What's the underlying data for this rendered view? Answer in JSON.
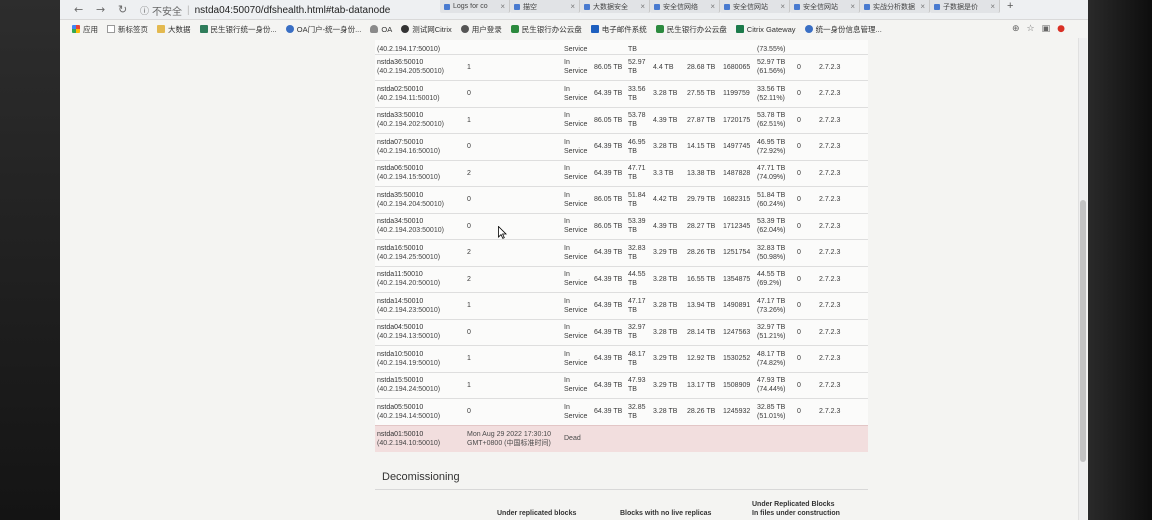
{
  "browser": {
    "tabs": [
      "Logs for co",
      "描空",
      "大数据安全",
      "安全信网络",
      "安全信网站",
      "安全信网站",
      "实战分析数据",
      "子数据是价"
    ],
    "security_label": "不安全",
    "url": "nstda04:50070/dfshealth.html#tab-datanode",
    "bookmarks": [
      {
        "label": "应用",
        "icon": "apps-icon"
      },
      {
        "label": "新标签页",
        "icon": "page-icon"
      },
      {
        "label": "大数据",
        "icon": "folder-icon"
      },
      {
        "label": "民生银行统一身份...",
        "icon": "bank-icon"
      },
      {
        "label": "OA门户-统一身份...",
        "icon": "globe-icon"
      },
      {
        "label": "OA",
        "icon": "cloud-icon"
      },
      {
        "label": "测试网Citrix",
        "icon": "citrix-icon"
      },
      {
        "label": "用户登录",
        "icon": "paw-icon"
      },
      {
        "label": "民生银行办公云盘",
        "icon": "drive-icon"
      },
      {
        "label": "电子邮件系统",
        "icon": "mail-icon"
      },
      {
        "label": "民生银行办公云盘",
        "icon": "drive-icon"
      },
      {
        "label": "Citrix Gateway",
        "icon": "gateway-icon"
      },
      {
        "label": "统一身份信息管理...",
        "icon": "globe-icon"
      }
    ],
    "toolbar_icons": [
      "zoom-icon",
      "bookmark-star-icon",
      "extension-icon",
      "profile-icon"
    ]
  },
  "datanodes": {
    "partial_row": {
      "address": "(40.2.194.17:50010)",
      "admin_state": "Service",
      "used": "TB",
      "block_pool_percent": "(73.55%)"
    },
    "rows": [
      {
        "node": "nstda36:50010",
        "address": "(40.2.194.205:50010)",
        "last_contact": "1",
        "admin_state": "In Service",
        "capacity": "86.05 TB",
        "used": "52.97 TB",
        "non_dfs_used": "4.4 TB",
        "remaining": "28.68 TB",
        "blocks": "1680065",
        "block_pool_used": "52.97 TB",
        "block_pool_percent": "(61.56%)",
        "failed_volumes": "0",
        "version": "2.7.2.3"
      },
      {
        "node": "nstda02:50010",
        "address": "(40.2.194.11:50010)",
        "last_contact": "0",
        "admin_state": "In Service",
        "capacity": "64.39 TB",
        "used": "33.56 TB",
        "non_dfs_used": "3.28 TB",
        "remaining": "27.55 TB",
        "blocks": "1199759",
        "block_pool_used": "33.56 TB",
        "block_pool_percent": "(52.11%)",
        "failed_volumes": "0",
        "version": "2.7.2.3"
      },
      {
        "node": "nstda33:50010",
        "address": "(40.2.194.202:50010)",
        "last_contact": "1",
        "admin_state": "In Service",
        "capacity": "86.05 TB",
        "used": "53.78 TB",
        "non_dfs_used": "4.39 TB",
        "remaining": "27.87 TB",
        "blocks": "1720175",
        "block_pool_used": "53.78 TB",
        "block_pool_percent": "(62.51%)",
        "failed_volumes": "0",
        "version": "2.7.2.3"
      },
      {
        "node": "nstda07:50010",
        "address": "(40.2.194.16:50010)",
        "last_contact": "0",
        "admin_state": "In Service",
        "capacity": "64.39 TB",
        "used": "46.95 TB",
        "non_dfs_used": "3.28 TB",
        "remaining": "14.15 TB",
        "blocks": "1497745",
        "block_pool_used": "46.95 TB",
        "block_pool_percent": "(72.92%)",
        "failed_volumes": "0",
        "version": "2.7.2.3"
      },
      {
        "node": "nstda06:50010",
        "address": "(40.2.194.15:50010)",
        "last_contact": "2",
        "admin_state": "In Service",
        "capacity": "64.39 TB",
        "used": "47.71 TB",
        "non_dfs_used": "3.3 TB",
        "remaining": "13.38 TB",
        "blocks": "1487828",
        "block_pool_used": "47.71 TB",
        "block_pool_percent": "(74.09%)",
        "failed_volumes": "0",
        "version": "2.7.2.3"
      },
      {
        "node": "nstda35:50010",
        "address": "(40.2.194.204:50010)",
        "last_contact": "0",
        "admin_state": "In Service",
        "capacity": "86.05 TB",
        "used": "51.84 TB",
        "non_dfs_used": "4.42 TB",
        "remaining": "29.79 TB",
        "blocks": "1682315",
        "block_pool_used": "51.84 TB",
        "block_pool_percent": "(60.24%)",
        "failed_volumes": "0",
        "version": "2.7.2.3"
      },
      {
        "node": "nstda34:50010",
        "address": "(40.2.194.203:50010)",
        "last_contact": "0",
        "admin_state": "In Service",
        "capacity": "86.05 TB",
        "used": "53.39 TB",
        "non_dfs_used": "4.39 TB",
        "remaining": "28.27 TB",
        "blocks": "1712345",
        "block_pool_used": "53.39 TB",
        "block_pool_percent": "(62.04%)",
        "failed_volumes": "0",
        "version": "2.7.2.3"
      },
      {
        "node": "nstda16:50010",
        "address": "(40.2.194.25:50010)",
        "last_contact": "2",
        "admin_state": "In Service",
        "capacity": "64.39 TB",
        "used": "32.83 TB",
        "non_dfs_used": "3.29 TB",
        "remaining": "28.26 TB",
        "blocks": "1251754",
        "block_pool_used": "32.83 TB",
        "block_pool_percent": "(50.98%)",
        "failed_volumes": "0",
        "version": "2.7.2.3"
      },
      {
        "node": "nstda11:50010",
        "address": "(40.2.194.20:50010)",
        "last_contact": "2",
        "admin_state": "In Service",
        "capacity": "64.39 TB",
        "used": "44.55 TB",
        "non_dfs_used": "3.28 TB",
        "remaining": "16.55 TB",
        "blocks": "1354875",
        "block_pool_used": "44.55 TB",
        "block_pool_percent": "(69.2%)",
        "failed_volumes": "0",
        "version": "2.7.2.3"
      },
      {
        "node": "nstda14:50010",
        "address": "(40.2.194.23:50010)",
        "last_contact": "1",
        "admin_state": "In Service",
        "capacity": "64.39 TB",
        "used": "47.17 TB",
        "non_dfs_used": "3.28 TB",
        "remaining": "13.94 TB",
        "blocks": "1490891",
        "block_pool_used": "47.17 TB",
        "block_pool_percent": "(73.26%)",
        "failed_volumes": "0",
        "version": "2.7.2.3"
      },
      {
        "node": "nstda04:50010",
        "address": "(40.2.194.13:50010)",
        "last_contact": "0",
        "admin_state": "In Service",
        "capacity": "64.39 TB",
        "used": "32.97 TB",
        "non_dfs_used": "3.28 TB",
        "remaining": "28.14 TB",
        "blocks": "1247563",
        "block_pool_used": "32.97 TB",
        "block_pool_percent": "(51.21%)",
        "failed_volumes": "0",
        "version": "2.7.2.3"
      },
      {
        "node": "nstda10:50010",
        "address": "(40.2.194.19:50010)",
        "last_contact": "1",
        "admin_state": "In Service",
        "capacity": "64.39 TB",
        "used": "48.17 TB",
        "non_dfs_used": "3.29 TB",
        "remaining": "12.92 TB",
        "blocks": "1530252",
        "block_pool_used": "48.17 TB",
        "block_pool_percent": "(74.82%)",
        "failed_volumes": "0",
        "version": "2.7.2.3"
      },
      {
        "node": "nstda15:50010",
        "address": "(40.2.194.24:50010)",
        "last_contact": "1",
        "admin_state": "In Service",
        "capacity": "64.39 TB",
        "used": "47.93 TB",
        "non_dfs_used": "3.29 TB",
        "remaining": "13.17 TB",
        "blocks": "1508909",
        "block_pool_used": "47.93 TB",
        "block_pool_percent": "(74.44%)",
        "failed_volumes": "0",
        "version": "2.7.2.3"
      },
      {
        "node": "nstda05:50010",
        "address": "(40.2.194.14:50010)",
        "last_contact": "0",
        "admin_state": "In Service",
        "capacity": "64.39 TB",
        "used": "32.85 TB",
        "non_dfs_used": "3.28 TB",
        "remaining": "28.26 TB",
        "blocks": "1245932",
        "block_pool_used": "32.85 TB",
        "block_pool_percent": "(51.01%)",
        "failed_volumes": "0",
        "version": "2.7.2.3"
      }
    ],
    "dead_row": {
      "node": "nstda01:50010",
      "address": "(40.2.194.10:50010)",
      "last_contact": "Mon Aug 29 2022 17:30:10 GMT+0800 (中国标准时间)",
      "admin_state": "Dead"
    }
  },
  "decommissioning": {
    "title": "Decomissioning",
    "headers": {
      "under_replicated": "Under replicated blocks",
      "no_live_replicas": "Blocks with no live replicas",
      "under_construction_line1": "Under Replicated Blocks",
      "under_construction_line2": "In files under construction"
    }
  }
}
